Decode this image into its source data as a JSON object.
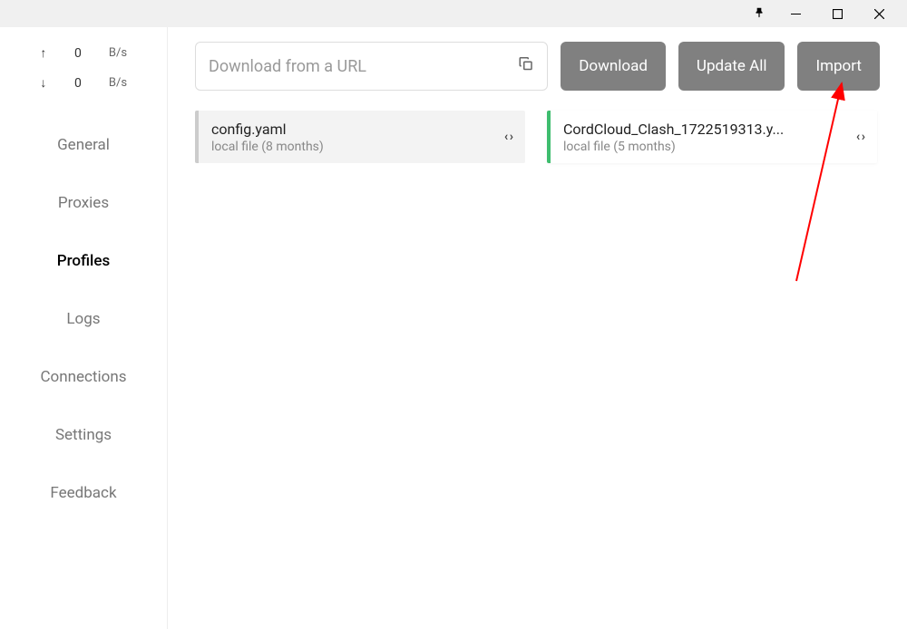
{
  "titlebar": {
    "pin": "📌",
    "minimize": "—",
    "maximize": "☐",
    "close": "✕"
  },
  "traffic": {
    "upload": {
      "arrow": "↑",
      "value": "0",
      "unit": "B/s"
    },
    "download": {
      "arrow": "↓",
      "value": "0",
      "unit": "B/s"
    }
  },
  "nav": {
    "general": "General",
    "proxies": "Proxies",
    "profiles": "Profiles",
    "logs": "Logs",
    "connections": "Connections",
    "settings": "Settings",
    "feedback": "Feedback"
  },
  "toolbar": {
    "url_placeholder": "Download from a URL",
    "download_label": "Download",
    "update_all_label": "Update All",
    "import_label": "Import"
  },
  "profiles": [
    {
      "name": "config.yaml",
      "meta": "local file (8 months)",
      "selected": false
    },
    {
      "name": "CordCloud_Clash_1722519313.y...",
      "meta": "local file (5 months)",
      "selected": true
    }
  ]
}
